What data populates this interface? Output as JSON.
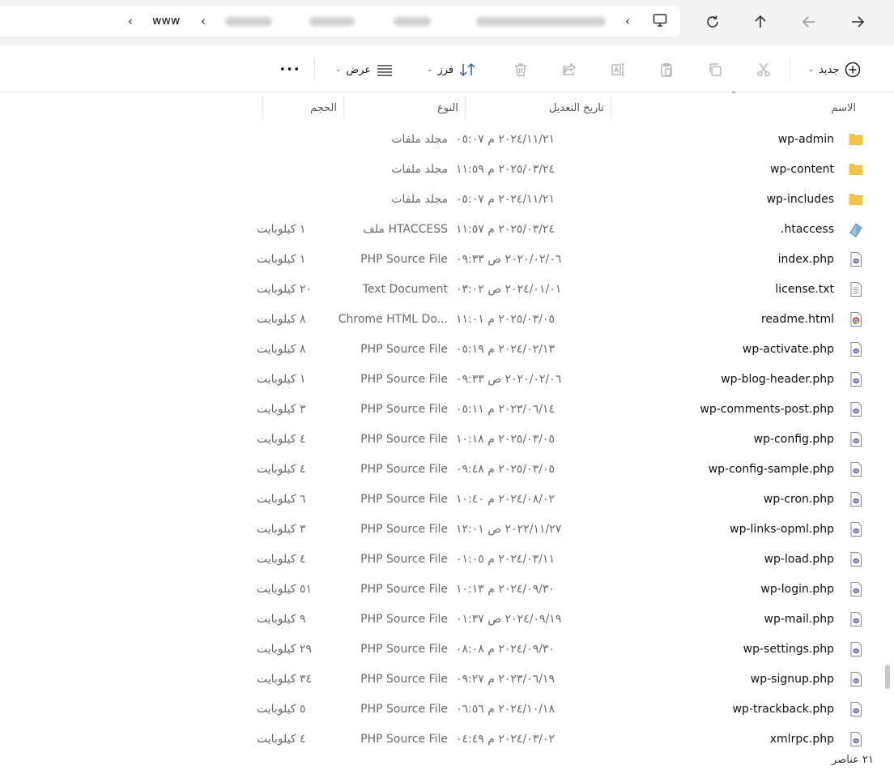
{
  "address_bar": {
    "current_folder": "www",
    "blurred_segments": 4
  },
  "command_bar": {
    "new_label": "جديد",
    "sort_label": "فرز",
    "view_label": "عرض",
    "more_label": "•••"
  },
  "columns": {
    "name": "الاسم",
    "date": "تاريخ التعديل",
    "type": "النوع",
    "size": "الحجم"
  },
  "files": [
    {
      "name": "wp-admin",
      "date": "٢٠٢٤/١١/٢١ م ٠٥:٠٧",
      "type": "مجلد ملفات",
      "size": "",
      "icon": "folder-icon"
    },
    {
      "name": "wp-content",
      "date": "٢٠٢٥/٠٣/٢٤ م ١١:٥٩",
      "type": "مجلد ملفات",
      "size": "",
      "icon": "folder-icon"
    },
    {
      "name": "wp-includes",
      "date": "٢٠٢٤/١١/٢١ م ٠٥:٠٧",
      "type": "مجلد ملفات",
      "size": "",
      "icon": "folder-icon"
    },
    {
      "name": ".htaccess",
      "date": "٢٠٢٥/٠٣/٢٤ م ١١:٥٧",
      "type": "ملف HTACCESS",
      "size": "١ كيلوبايت",
      "icon": "htaccess-file-icon"
    },
    {
      "name": "index.php",
      "date": "٢٠٢٠/٠٢/٠٦ ص ٠٩:٣٣",
      "type": "PHP Source File",
      "size": "١ كيلوبايت",
      "icon": "php-file-icon"
    },
    {
      "name": "license.txt",
      "date": "٢٠٢٤/٠١/٠١ ص ٠٣:٠٢",
      "type": "Text Document",
      "size": "٢٠ كيلوبايت",
      "icon": "text-file-icon"
    },
    {
      "name": "readme.html",
      "date": "٢٠٢٥/٠٣/٠٥ م ١١:٠١",
      "type": "Chrome HTML Do...",
      "size": "٨ كيلوبايت",
      "icon": "chrome-html-icon"
    },
    {
      "name": "wp-activate.php",
      "date": "٢٠٢٤/٠٢/١٣ م ٠٥:١٩",
      "type": "PHP Source File",
      "size": "٨ كيلوبايت",
      "icon": "php-file-icon"
    },
    {
      "name": "wp-blog-header.php",
      "date": "٢٠٢٠/٠٢/٠٦ ص ٠٩:٣٣",
      "type": "PHP Source File",
      "size": "١ كيلوبايت",
      "icon": "php-file-icon"
    },
    {
      "name": "wp-comments-post.php",
      "date": "٢٠٢٣/٠٦/١٤ م ٠٥:١١",
      "type": "PHP Source File",
      "size": "٣ كيلوبايت",
      "icon": "php-file-icon"
    },
    {
      "name": "wp-config.php",
      "date": "٢٠٢٥/٠٣/٠٥ م ١٠:١٨",
      "type": "PHP Source File",
      "size": "٤ كيلوبايت",
      "icon": "php-file-icon"
    },
    {
      "name": "wp-config-sample.php",
      "date": "٢٠٢٥/٠٣/٠٥ م ٠٩:٤٨",
      "type": "PHP Source File",
      "size": "٤ كيلوبايت",
      "icon": "php-file-icon"
    },
    {
      "name": "wp-cron.php",
      "date": "٢٠٢٤/٠٨/٠٢ م ١٠:٤٠",
      "type": "PHP Source File",
      "size": "٦ كيلوبايت",
      "icon": "php-file-icon"
    },
    {
      "name": "wp-links-opml.php",
      "date": "٢٠٢٢/١١/٢٧ ص ١٢:٠١",
      "type": "PHP Source File",
      "size": "٣ كيلوبايت",
      "icon": "php-file-icon"
    },
    {
      "name": "wp-load.php",
      "date": "٢٠٢٤/٠٣/١١ م ٠١:٠٥",
      "type": "PHP Source File",
      "size": "٤ كيلوبايت",
      "icon": "php-file-icon"
    },
    {
      "name": "wp-login.php",
      "date": "٢٠٢٤/٠٩/٣٠ م ١٠:١٣",
      "type": "PHP Source File",
      "size": "٥١ كيلوبايت",
      "icon": "php-file-icon"
    },
    {
      "name": "wp-mail.php",
      "date": "٢٠٢٤/٠٩/١٩ ص ٠١:٣٧",
      "type": "PHP Source File",
      "size": "٩ كيلوبايت",
      "icon": "php-file-icon"
    },
    {
      "name": "wp-settings.php",
      "date": "٢٠٢٤/٠٩/٣٠ م ٠٨:٠٨",
      "type": "PHP Source File",
      "size": "٢٩ كيلوبايت",
      "icon": "php-file-icon"
    },
    {
      "name": "wp-signup.php",
      "date": "٢٠٢٣/٠٦/١٩ م ٠٩:٢٧",
      "type": "PHP Source File",
      "size": "٣٤ كيلوبايت",
      "icon": "php-file-icon"
    },
    {
      "name": "wp-trackback.php",
      "date": "٢٠٢٤/١٠/١٨ م ٠٦:٥٦",
      "type": "PHP Source File",
      "size": "٥ كيلوبايت",
      "icon": "php-file-icon"
    },
    {
      "name": "xmlrpc.php",
      "date": "٢٠٢٤/٠٣/٠٢ م ٠٤:٤٩",
      "type": "PHP Source File",
      "size": "٤ كيلوبايت",
      "icon": "php-file-icon"
    }
  ],
  "status_bar": {
    "item_count": "٢١ عناصر"
  },
  "colors": {
    "folder": "#f5c542",
    "php": "#7a6bb5",
    "accent": "#005fb8"
  }
}
